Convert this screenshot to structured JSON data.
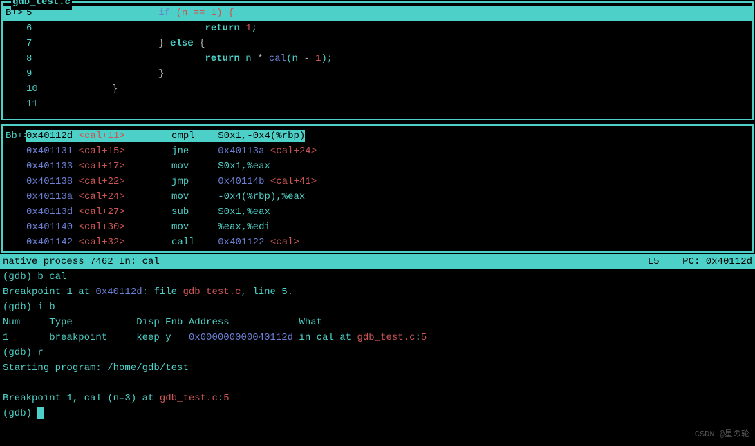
{
  "source": {
    "filename": "gdb_test.c",
    "lines": [
      {
        "bp": "B+>",
        "num": "5",
        "tokens": [
          {
            "t": "                  ",
            "c": "plain"
          },
          {
            "t": "if ",
            "c": "kw-if"
          },
          {
            "t": "(n == 1) {",
            "c": "paren-red"
          }
        ],
        "hl": true
      },
      {
        "bp": "",
        "num": "6",
        "tokens": [
          {
            "t": "                          ",
            "c": "plain"
          },
          {
            "t": "return ",
            "c": "kw"
          },
          {
            "t": "1",
            "c": "num"
          },
          {
            "t": ";",
            "c": "plain"
          }
        ]
      },
      {
        "bp": "",
        "num": "7",
        "tokens": [
          {
            "t": "                  ",
            "c": "plain"
          },
          {
            "t": "}",
            "c": "brace-y"
          },
          {
            "t": " ",
            "c": "plain"
          },
          {
            "t": "else",
            "c": "kw"
          },
          {
            "t": " ",
            "c": "plain"
          },
          {
            "t": "{",
            "c": "brace-y"
          }
        ]
      },
      {
        "bp": "",
        "num": "8",
        "tokens": [
          {
            "t": "                          ",
            "c": "plain"
          },
          {
            "t": "return ",
            "c": "kw"
          },
          {
            "t": "n ",
            "c": "plain"
          },
          {
            "t": "* ",
            "c": "op"
          },
          {
            "t": "cal",
            "c": "fn"
          },
          {
            "t": "(n ",
            "c": "plain"
          },
          {
            "t": "- ",
            "c": "op"
          },
          {
            "t": "1",
            "c": "num"
          },
          {
            "t": ");",
            "c": "plain"
          }
        ]
      },
      {
        "bp": "",
        "num": "9",
        "tokens": [
          {
            "t": "                  ",
            "c": "plain"
          },
          {
            "t": "}",
            "c": "brace-y"
          }
        ]
      },
      {
        "bp": "",
        "num": "10",
        "tokens": [
          {
            "t": "          ",
            "c": "plain"
          },
          {
            "t": "}",
            "c": "brace-y"
          }
        ]
      },
      {
        "bp": "",
        "num": "11",
        "tokens": []
      }
    ]
  },
  "asm": {
    "lines": [
      {
        "bp": "Bb+>",
        "hl": true,
        "addr": "0x40112d",
        "sym": "<cal+11>",
        "mnem": "cmpl",
        "args": "$0x1,-0x4(%rbp)",
        "target": "",
        "tsym": ""
      },
      {
        "bp": "",
        "addr": "0x401131",
        "sym": "<cal+15>",
        "mnem": "jne",
        "args": "",
        "target": "0x40113a",
        "tsym": "<cal+24>"
      },
      {
        "bp": "",
        "addr": "0x401133",
        "sym": "<cal+17>",
        "mnem": "mov",
        "args": "$0x1,%eax",
        "target": "",
        "tsym": ""
      },
      {
        "bp": "",
        "addr": "0x401138",
        "sym": "<cal+22>",
        "mnem": "jmp",
        "args": "",
        "target": "0x40114b",
        "tsym": "<cal+41>"
      },
      {
        "bp": "",
        "addr": "0x40113a",
        "sym": "<cal+24>",
        "mnem": "mov",
        "args": "-0x4(%rbp),%eax",
        "target": "",
        "tsym": ""
      },
      {
        "bp": "",
        "addr": "0x40113d",
        "sym": "<cal+27>",
        "mnem": "sub",
        "args": "$0x1,%eax",
        "target": "",
        "tsym": ""
      },
      {
        "bp": "",
        "addr": "0x401140",
        "sym": "<cal+30>",
        "mnem": "mov",
        "args": "%eax,%edi",
        "target": "",
        "tsym": ""
      },
      {
        "bp": "",
        "addr": "0x401142",
        "sym": "<cal+32>",
        "mnem": "call",
        "args": "",
        "target": "0x401122",
        "tsym": "<cal>"
      }
    ]
  },
  "status": {
    "left": "native process 7462 In: cal",
    "right": "L5    PC: 0x40112d"
  },
  "console": {
    "lines": [
      [
        {
          "t": "(gdb) ",
          "c": "c-prompt"
        },
        {
          "t": "b cal",
          "c": "c-plain"
        }
      ],
      [
        {
          "t": "Breakpoint 1 at ",
          "c": "c-plain"
        },
        {
          "t": "0x40112d",
          "c": "c-addr"
        },
        {
          "t": ": file ",
          "c": "c-plain"
        },
        {
          "t": "gdb_test.c",
          "c": "c-file"
        },
        {
          "t": ", line 5.",
          "c": "c-plain"
        }
      ],
      [
        {
          "t": "(gdb) ",
          "c": "c-prompt"
        },
        {
          "t": "i b",
          "c": "c-plain"
        }
      ],
      [
        {
          "t": "Num     Type           Disp Enb Address            What",
          "c": "c-plain"
        }
      ],
      [
        {
          "t": "1       breakpoint     keep y   ",
          "c": "c-plain"
        },
        {
          "t": "0x000000000040112d",
          "c": "c-addr"
        },
        {
          "t": " in cal at ",
          "c": "c-plain"
        },
        {
          "t": "gdb_test.c",
          "c": "c-file"
        },
        {
          "t": ":",
          "c": "c-plain"
        },
        {
          "t": "5",
          "c": "c-num"
        }
      ],
      [
        {
          "t": "(gdb) ",
          "c": "c-prompt"
        },
        {
          "t": "r",
          "c": "c-plain"
        }
      ],
      [
        {
          "t": "Starting program: /home/gdb/test",
          "c": "c-plain"
        }
      ],
      [
        {
          "t": " ",
          "c": "c-plain"
        }
      ],
      [
        {
          "t": "Breakpoint 1, cal (n=3) at ",
          "c": "c-plain"
        },
        {
          "t": "gdb_test.c",
          "c": "c-file"
        },
        {
          "t": ":",
          "c": "c-plain"
        },
        {
          "t": "5",
          "c": "c-num"
        }
      ]
    ],
    "prompt": "(gdb) "
  },
  "watermark": "CSDN @星の轮"
}
